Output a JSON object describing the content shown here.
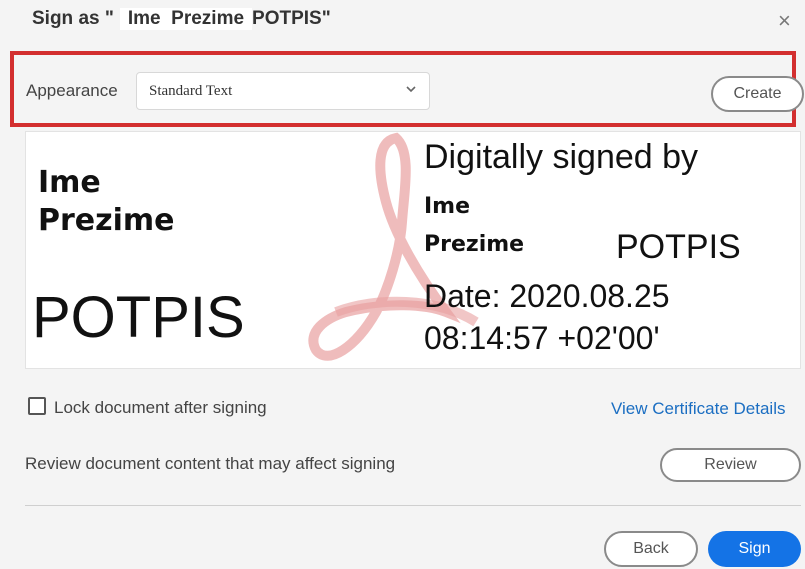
{
  "dialog": {
    "title_prefix": "Sign as \"",
    "title_name": "Ime  Prezime",
    "title_suffix": "POTPIS\"",
    "close_glyph": "×"
  },
  "appearance": {
    "label": "Appearance",
    "selected": "Standard Text",
    "create_label": "Create"
  },
  "preview": {
    "left_line1": "Ime",
    "left_line2": "Prezime",
    "left_line3": "POTPIS",
    "right_line1": "Digitally signed by",
    "right_line2": "Ime",
    "right_line3": "Prezime",
    "right_line4": "POTPIS",
    "right_line5": "Date: 2020.08.25",
    "right_line6": "08:14:57 +02'00'",
    "watermark_icon": "acrobat-logo-icon",
    "watermark_color": "#e8a0a0"
  },
  "options": {
    "lock_label": "Lock document after signing",
    "lock_checked": false,
    "view_cert_label": "View Certificate Details",
    "review_text": "Review document content that may affect signing",
    "review_label": "Review"
  },
  "footer": {
    "back_label": "Back",
    "sign_label": "Sign"
  },
  "colors": {
    "accent": "#1473e6",
    "highlight_border": "#d32f2f",
    "link": "#1b6ec2"
  }
}
